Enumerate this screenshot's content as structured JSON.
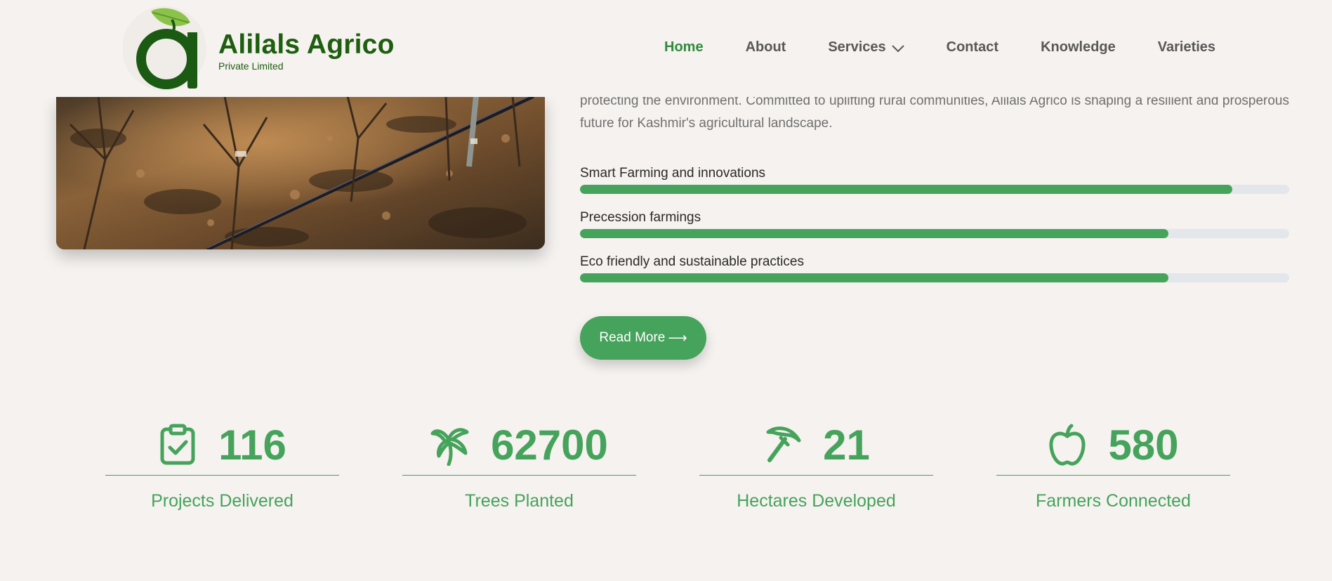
{
  "brand": {
    "name": "Alilals Agrico",
    "subtitle": "Private Limited"
  },
  "nav": {
    "items": [
      {
        "label": "Home",
        "active": true
      },
      {
        "label": "About",
        "active": false
      },
      {
        "label": "Services",
        "active": false,
        "has_dropdown": true
      },
      {
        "label": "Contact",
        "active": false
      },
      {
        "label": "Knowledge",
        "active": false
      },
      {
        "label": "Varieties",
        "active": false
      }
    ]
  },
  "about": {
    "paragraph": "protecting the environment. Committed to uplifting rural communities, Alilals Agrico is shaping a resilient and prosperous future for Kashmir's agricultural landscape.",
    "read_more_label": "Read More",
    "read_more_arrow": "⟶"
  },
  "skills": [
    {
      "label": "Smart Farming and innovations",
      "percent": 92
    },
    {
      "label": "Precession farmings",
      "percent": 83
    },
    {
      "label": "Eco friendly and sustainable practices",
      "percent": 83
    }
  ],
  "stats": [
    {
      "number": "116",
      "label": "Projects Delivered",
      "icon": "clipboard-check-icon"
    },
    {
      "number": "62700",
      "label": "Trees Planted",
      "icon": "palm-tree-icon"
    },
    {
      "number": "21",
      "label": "Hectares Developed",
      "icon": "pickaxe-icon"
    },
    {
      "number": "580",
      "label": "Farmers Connected",
      "icon": "apple-icon"
    }
  ],
  "colors": {
    "background": "#f5f2ef",
    "brand_green": "#1d5e0f",
    "accent_green": "#45a35b",
    "nav_active": "#2f8a3b",
    "nav_text": "#585858",
    "track": "#e3e6ea"
  }
}
